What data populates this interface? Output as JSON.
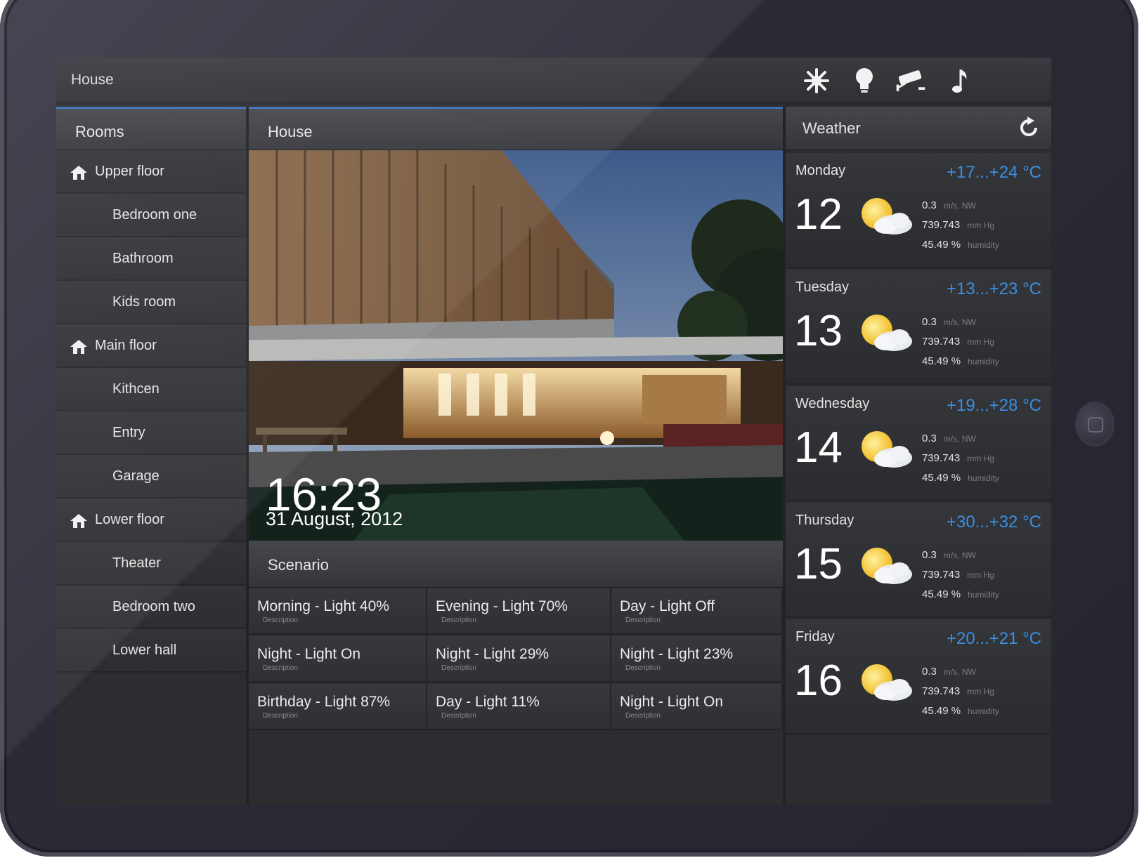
{
  "topbar": {
    "title": "House",
    "icons": [
      "climate-icon",
      "light-bulb-icon",
      "security-camera-icon",
      "music-note-icon"
    ]
  },
  "rooms": {
    "header": "Rooms",
    "items": [
      {
        "label": "Upper floor",
        "type": "floor"
      },
      {
        "label": "Bedroom one",
        "type": "room"
      },
      {
        "label": "Bathroom",
        "type": "room"
      },
      {
        "label": "Kids room",
        "type": "room"
      },
      {
        "label": "Main floor",
        "type": "floor"
      },
      {
        "label": "Kithcen",
        "type": "room"
      },
      {
        "label": "Entry",
        "type": "room"
      },
      {
        "label": "Garage",
        "type": "room"
      },
      {
        "label": "Lower floor",
        "type": "floor"
      },
      {
        "label": "Theater",
        "type": "room"
      },
      {
        "label": "Bedroom two",
        "type": "room"
      },
      {
        "label": "Lower hall",
        "type": "room"
      }
    ]
  },
  "main": {
    "header": "House",
    "clock": {
      "time": "16:23",
      "date": "31 August, 2012"
    },
    "scenario": {
      "header": "Scenario",
      "items": [
        {
          "name": "Morning - Light 40%",
          "desc": "Description"
        },
        {
          "name": "Evening - Light 70%",
          "desc": "Description"
        },
        {
          "name": "Day - Light Off",
          "desc": "Description"
        },
        {
          "name": "Night - Light On",
          "desc": "Description"
        },
        {
          "name": "Night - Light 29%",
          "desc": "Description"
        },
        {
          "name": "Night - Light 23%",
          "desc": "Description"
        },
        {
          "name": "Birthday - Light 87%",
          "desc": "Description"
        },
        {
          "name": "Day - Light 11%",
          "desc": "Description"
        },
        {
          "name": "Night - Light On",
          "desc": "Description"
        }
      ]
    }
  },
  "weather": {
    "header": "Weather",
    "days": [
      {
        "day": "Monday",
        "date": "12",
        "range": "+17...+24 °C",
        "wind": "0.3",
        "wind_unit": "m/s, NW",
        "pressure": "739.743",
        "pressure_unit": "mm Hg",
        "humidity": "45.49 %",
        "humidity_unit": "humidity"
      },
      {
        "day": "Tuesday",
        "date": "13",
        "range": "+13...+23 °C",
        "wind": "0.3",
        "wind_unit": "m/s, NW",
        "pressure": "739.743",
        "pressure_unit": "mm Hg",
        "humidity": "45.49 %",
        "humidity_unit": "humidity"
      },
      {
        "day": "Wednesday",
        "date": "14",
        "range": "+19...+28 °C",
        "wind": "0.3",
        "wind_unit": "m/s, NW",
        "pressure": "739.743",
        "pressure_unit": "mm Hg",
        "humidity": "45.49 %",
        "humidity_unit": "humidity"
      },
      {
        "day": "Thursday",
        "date": "15",
        "range": "+30...+32 °C",
        "wind": "0.3",
        "wind_unit": "m/s, NW",
        "pressure": "739.743",
        "pressure_unit": "mm Hg",
        "humidity": "45.49 %",
        "humidity_unit": "humidity"
      },
      {
        "day": "Friday",
        "date": "16",
        "range": "+20...+21 °C",
        "wind": "0.3",
        "wind_unit": "m/s, NW",
        "pressure": "739.743",
        "pressure_unit": "mm Hg",
        "humidity": "45.49 %",
        "humidity_unit": "humidity"
      }
    ]
  },
  "colors": {
    "accent": "#3a6fb5",
    "temperature": "#3a8fe0",
    "panel": "#2c2d31"
  }
}
